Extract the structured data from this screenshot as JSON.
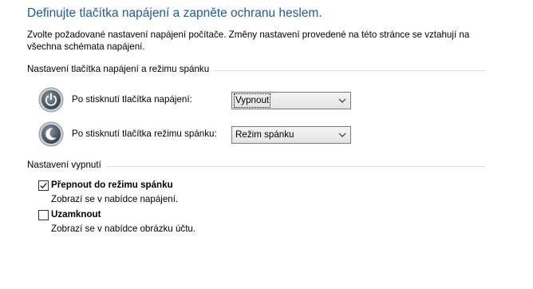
{
  "header": {
    "title": "Definujte tlačítka napájení a zapněte ochranu heslem.",
    "description": "Zvolte požadované nastavení napájení počítače. Změny nastavení provedené na této stránce se vztahují na všechna schémata napájení."
  },
  "power_buttons_section": {
    "title": "Nastavení tlačítka napájení a režimu spánku",
    "rows": [
      {
        "label": "Po stisknutí tlačítka napájení:",
        "icon": "power-button-icon",
        "selected": "Vypnout",
        "focused": true
      },
      {
        "label": "Po stisknutí tlačítka režimu spánku:",
        "icon": "sleep-moon-icon",
        "selected": "Režim spánku",
        "focused": false
      }
    ]
  },
  "shutdown_section": {
    "title": "Nastavení vypnutí",
    "options": [
      {
        "label": "Přepnout do režimu spánku",
        "description": "Zobrazí se v nabídce napájení.",
        "checked": true
      },
      {
        "label": "Uzamknout",
        "description": "Zobrazí se v nabídce obrázku účtu.",
        "checked": false
      }
    ]
  },
  "colors": {
    "title_blue": "#1e5aa8",
    "divider": "#dcdcdc",
    "dropdown_border": "#7a7a7a"
  }
}
